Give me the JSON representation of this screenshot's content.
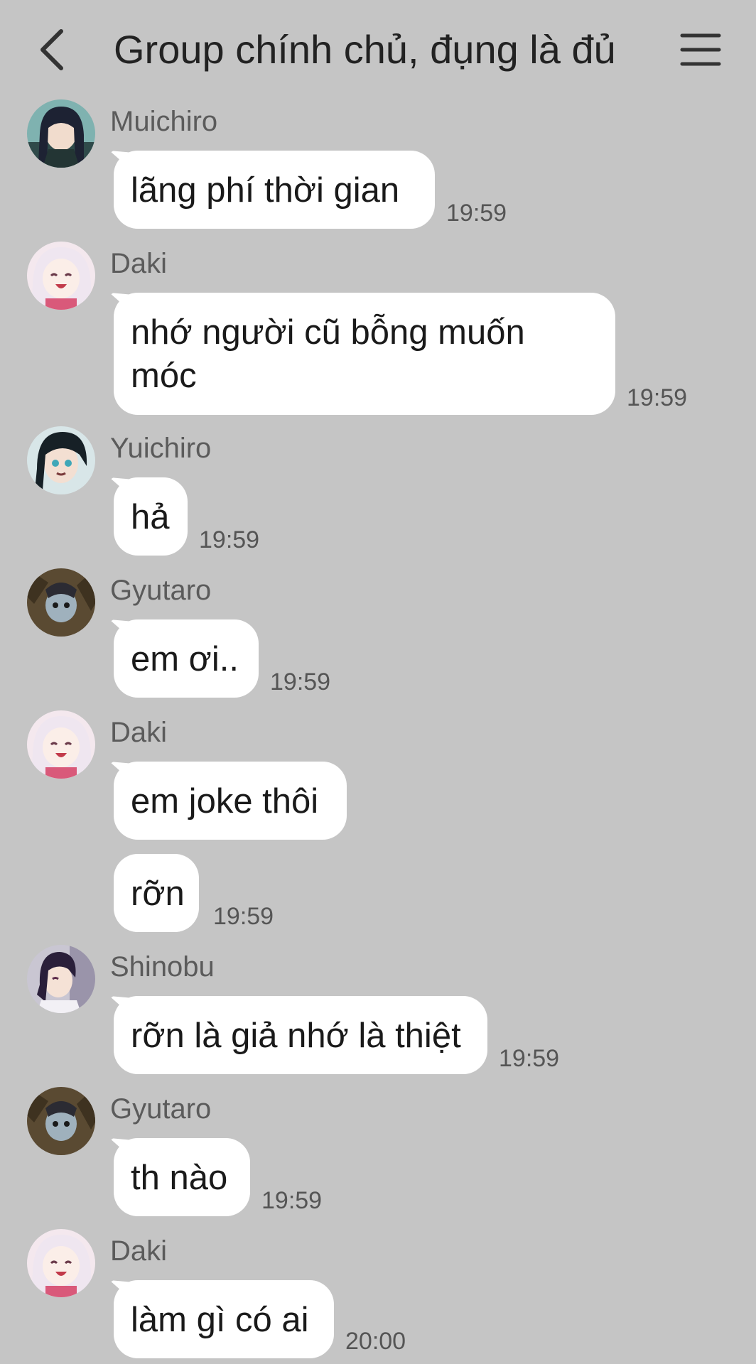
{
  "header": {
    "title": "Group chính chủ, đụng là đủ",
    "back_icon": "chevron-left-icon",
    "menu_icon": "hamburger-menu-icon"
  },
  "messages": [
    {
      "sender": "Muichiro",
      "text": "lãng phí thời gian",
      "time": "19:59"
    },
    {
      "sender": "Daki",
      "text": "nhớ người cũ bỗng muốn móc",
      "time": "19:59"
    },
    {
      "sender": "Yuichiro",
      "text": "hả",
      "time": "19:59"
    },
    {
      "sender": "Gyutaro",
      "text": "em ơi..",
      "time": "19:59"
    },
    {
      "sender": "Daki",
      "text": "em joke thôi",
      "time": ""
    },
    {
      "sender": "",
      "text": "rỡn",
      "time": "19:59"
    },
    {
      "sender": "Shinobu",
      "text": "rỡn là giả nhớ là thiệt",
      "time": "19:59"
    },
    {
      "sender": "Gyutaro",
      "text": "th nào",
      "time": "19:59"
    },
    {
      "sender": "Daki",
      "text": "làm gì có ai",
      "time": "20:00"
    }
  ],
  "colors": {
    "background": "#c5c5c5",
    "bubble": "#ffffff",
    "timestamp": "#555555",
    "sender_name": "#5b5b5b"
  }
}
